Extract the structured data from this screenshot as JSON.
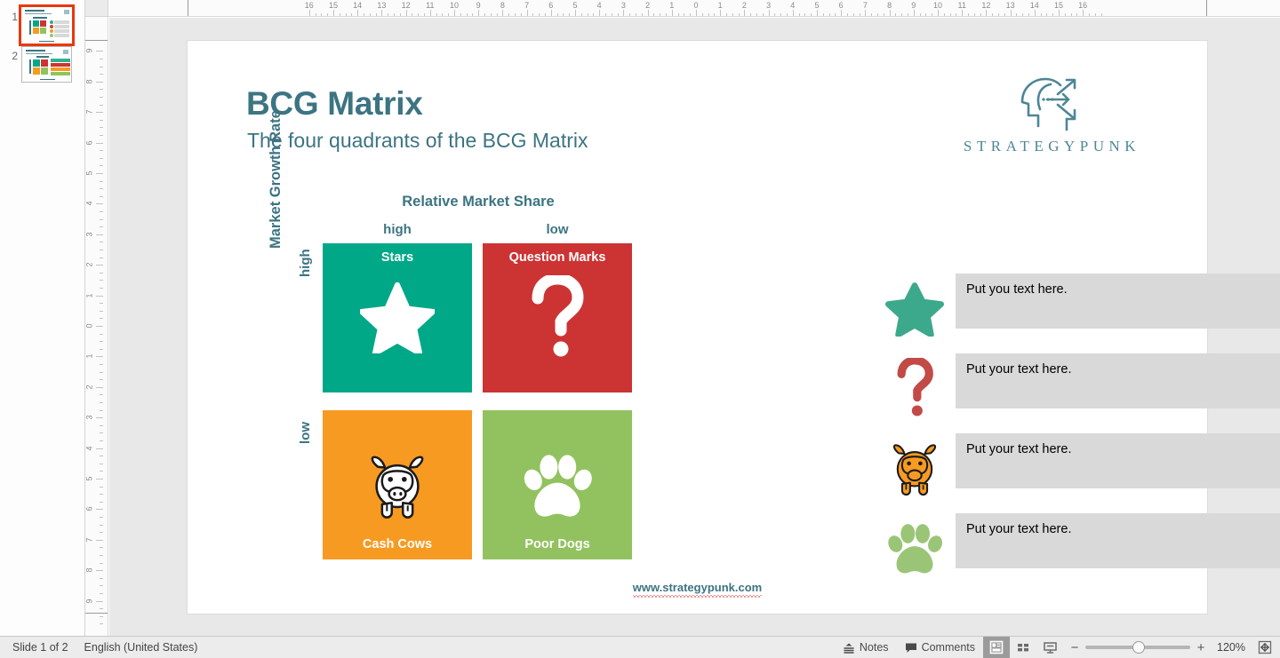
{
  "app": {
    "status": {
      "slide_counter": "Slide 1 of 2",
      "language": "English (United States)",
      "notes_label": "Notes",
      "comments_label": "Comments",
      "zoom_level": "120%",
      "zoom_minus": "−",
      "zoom_plus": "+",
      "normal_view_icon": "normal-view-icon",
      "sorter_view_icon": "slide-sorter-icon",
      "present_icon": "presentation-icon",
      "fit_icon": "fit-slide-icon",
      "notes_icon": "notes-icon",
      "comments_icon": "comment-bubble-icon"
    }
  },
  "slide_panel": {
    "slides": [
      {
        "number": "1",
        "selected": true
      },
      {
        "number": "2",
        "selected": false
      }
    ]
  },
  "rulers": {
    "horizontal_labels": [
      "16",
      "15",
      "14",
      "13",
      "12",
      "11",
      "10",
      "9",
      "8",
      "7",
      "6",
      "5",
      "4",
      "3",
      "2",
      "1",
      "0",
      "1",
      "2",
      "3",
      "4",
      "5",
      "6",
      "7",
      "8",
      "9",
      "10",
      "11",
      "12",
      "13",
      "14",
      "15",
      "16"
    ],
    "vertical_labels": [
      "9",
      "8",
      "7",
      "6",
      "5",
      "4",
      "3",
      "2",
      "1",
      "0",
      "1",
      "2",
      "3",
      "4",
      "5",
      "6",
      "7",
      "8",
      "9"
    ],
    "unit": "inches"
  },
  "slide": {
    "title": "BCG Matrix",
    "subtitle": "The four quadrants of the BCG Matrix",
    "logo": {
      "wordmark": "STRATEGYPUNK",
      "icon_name": "strategypunk-head-arrows-logo",
      "color": "#4d8696"
    },
    "footer_url": "www.strategypunk.com",
    "matrix": {
      "x_axis_title": "Relative Market Share",
      "y_axis_title": "Market Growth Rate",
      "column_labels": [
        "high",
        "low"
      ],
      "row_labels": [
        "high",
        "low"
      ],
      "label_color": "#3c7482",
      "quadrants": [
        {
          "label": "Stars",
          "label_position": "top",
          "color": "#00a887",
          "icon": "star-icon"
        },
        {
          "label": "Question Marks",
          "label_position": "top",
          "color": "#cc3333",
          "icon": "question-mark-icon"
        },
        {
          "label": "Cash Cows",
          "label_position": "bottom",
          "color": "#f79a22",
          "icon": "cow-icon"
        },
        {
          "label": "Poor Dogs",
          "label_position": "bottom",
          "color": "#92c25f",
          "icon": "paw-print-icon"
        }
      ]
    },
    "items": [
      {
        "icon": "star-icon",
        "icon_color": "#3da98c",
        "text": "Put you text here."
      },
      {
        "icon": "question-mark-icon",
        "icon_color": "#c24a47",
        "text": "Put your text here."
      },
      {
        "icon": "cow-icon",
        "icon_color": "#f79a22",
        "text": "Put your text here."
      },
      {
        "icon": "paw-print-icon",
        "icon_color": "#9ac577",
        "text": "Put your text here."
      }
    ]
  }
}
